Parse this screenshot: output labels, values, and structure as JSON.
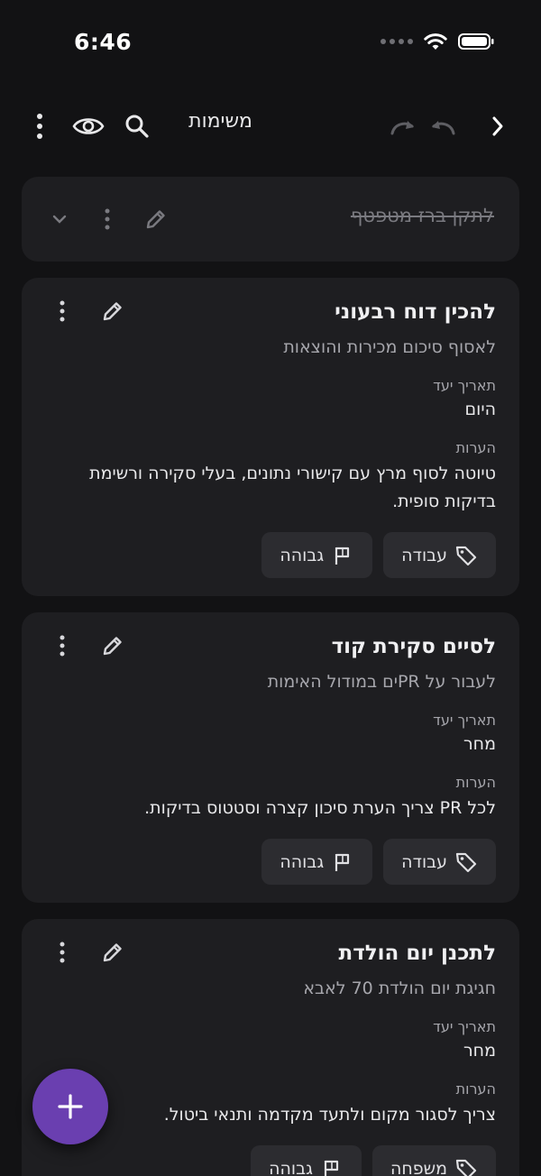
{
  "status_bar": {
    "time": "6:46"
  },
  "app_bar": {
    "title": "משימות"
  },
  "collapsed_task": {
    "title": "לתקן ברז מטפטף"
  },
  "labels": {
    "due_date": "תאריך יעד",
    "notes": "הערות"
  },
  "tasks": [
    {
      "title": "להכין דוח רבעוני",
      "subtitle": "לאסוף סיכום מכירות והוצאות",
      "due": "היום",
      "notes": "טיוטה לסוף מרץ עם קישורי נתונים, בעלי סקירה ורשימת בדיקות סופית.",
      "category": "עבודה",
      "priority": "גבוהה"
    },
    {
      "title": "לסיים סקירת קוד",
      "subtitle": "לעבור על PRים במודול האימות",
      "due": "מחר",
      "notes": "לכל PR צריך הערת סיכון קצרה וסטטוס בדיקות.",
      "category": "עבודה",
      "priority": "גבוהה"
    },
    {
      "title": "לתכנן יום הולדת",
      "subtitle": "חגיגת יום הולדת 70 לאבא",
      "due": "מחר",
      "notes": "צריך לסגור מקום ולתעד מקדמה ותנאי ביטול.",
      "category": "משפחה",
      "priority": "גבוהה"
    }
  ],
  "colors": {
    "background": "#121214",
    "card": "#1e1e21",
    "chip": "#2c2c30",
    "fab": "#6a3fb0"
  }
}
